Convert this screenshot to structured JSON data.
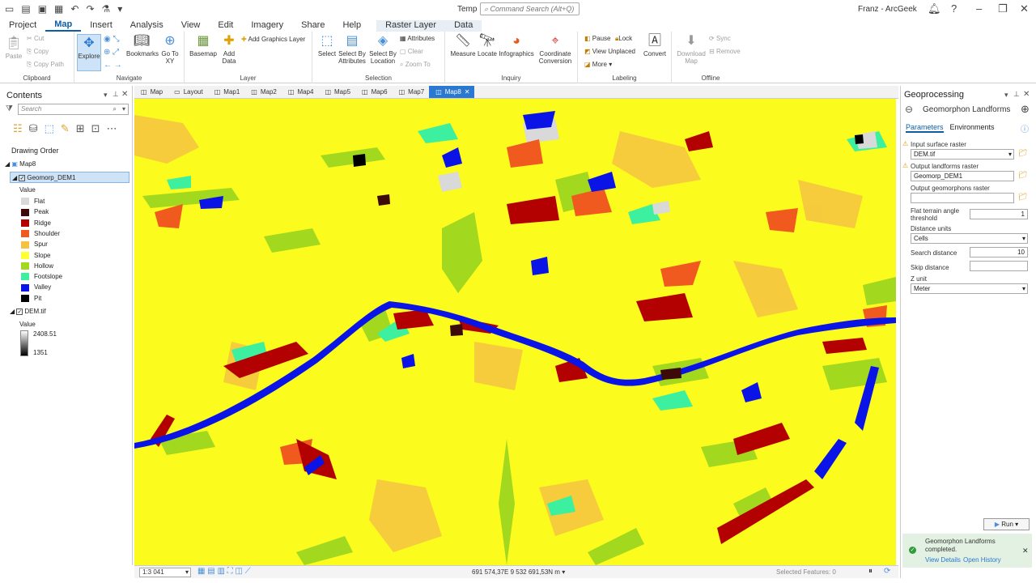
{
  "titlebar": {
    "doc_title": "Temp",
    "search_placeholder": "Command Search (Alt+Q)",
    "user_name": "Franz - ArcGeek"
  },
  "ribbon_tabs": [
    "Project",
    "Map",
    "Insert",
    "Analysis",
    "View",
    "Edit",
    "Imagery",
    "Share",
    "Help",
    "Raster Layer",
    "Data"
  ],
  "ribbon": {
    "clipboard": {
      "paste": "Paste",
      "cut": "Cut",
      "copy": "Copy",
      "copy_path": "Copy Path",
      "label": "Clipboard"
    },
    "navigate": {
      "explore": "Explore",
      "bookmarks": "Bookmarks",
      "goto": "Go To XY",
      "label": "Navigate"
    },
    "layer": {
      "basemap": "Basemap",
      "add_data": "Add Data",
      "add_graphics": "Add Graphics Layer",
      "label": "Layer"
    },
    "selection": {
      "select": "Select",
      "by_attr": "Select By Attributes",
      "by_loc": "Select By Location",
      "attributes": "Attributes",
      "clear": "Clear",
      "zoom_to": "Zoom To",
      "label": "Selection"
    },
    "inquiry": {
      "measure": "Measure",
      "locate": "Locate",
      "infographics": "Infographics",
      "coord_conv": "Coordinate Conversion",
      "label": "Inquiry"
    },
    "labeling": {
      "pause": "Pause",
      "lock": "Lock",
      "view_unplaced": "View Unplaced",
      "more": "More",
      "convert": "Convert",
      "label": "Labeling"
    },
    "offline": {
      "download": "Download Map",
      "sync": "Sync",
      "remove": "Remove",
      "label": "Offline"
    }
  },
  "contents": {
    "title": "Contents",
    "search_placeholder": "Search",
    "drawing_order": "Drawing Order",
    "map_name": "Map8",
    "layer1": "Geomorp_DEM1",
    "value_label": "Value",
    "legend": [
      {
        "label": "Flat",
        "color": "#d9d9d9"
      },
      {
        "label": "Peak",
        "color": "#3d0a0a"
      },
      {
        "label": "Ridge",
        "color": "#b30000"
      },
      {
        "label": "Shoulder",
        "color": "#f05a1e"
      },
      {
        "label": "Spur",
        "color": "#f5c242"
      },
      {
        "label": "Slope",
        "color": "#ffff33"
      },
      {
        "label": "Hollow",
        "color": "#a2d81e"
      },
      {
        "label": "Footslope",
        "color": "#3df0a0"
      },
      {
        "label": "Valley",
        "color": "#0a14e6"
      },
      {
        "label": "Pit",
        "color": "#000000"
      }
    ],
    "layer2": "DEM.tif",
    "dem_value_label": "Value",
    "dem_high": "2408.51",
    "dem_low": "1351"
  },
  "map_tabs": [
    "Map",
    "Layout",
    "Map1",
    "Map2",
    "Map4",
    "Map5",
    "Map6",
    "Map7",
    "Map8"
  ],
  "statusbar": {
    "scale": "1:3 041",
    "coords": "691 574,37E 9 532 691,53N m",
    "selected": "Selected Features: 0"
  },
  "geoprocessing": {
    "title": "Geoprocessing",
    "tool": "Geomorphon Landforms",
    "tab_params": "Parameters",
    "tab_env": "Environments",
    "input_surface_label": "Input surface raster",
    "input_surface": "DEM.tif",
    "output_landforms_label": "Output landforms raster",
    "output_landforms": "Geomorp_DEM1",
    "output_geomorphons_label": "Output geomorphons raster",
    "output_geomorphons": "",
    "flat_label_1": "Flat terrain angle",
    "flat_label_2": "threshold",
    "flat_value": "1",
    "distance_units_label": "Distance units",
    "distance_units": "Cells",
    "search_distance_label": "Search distance",
    "search_distance": "10",
    "skip_distance_label": "Skip distance",
    "skip_distance": "",
    "z_unit_label": "Z unit",
    "z_unit": "Meter",
    "run": "Run",
    "msg_title": "Geomorphon Landforms",
    "msg_status": "completed.",
    "view_details": "View Details",
    "open_history": "Open History"
  }
}
